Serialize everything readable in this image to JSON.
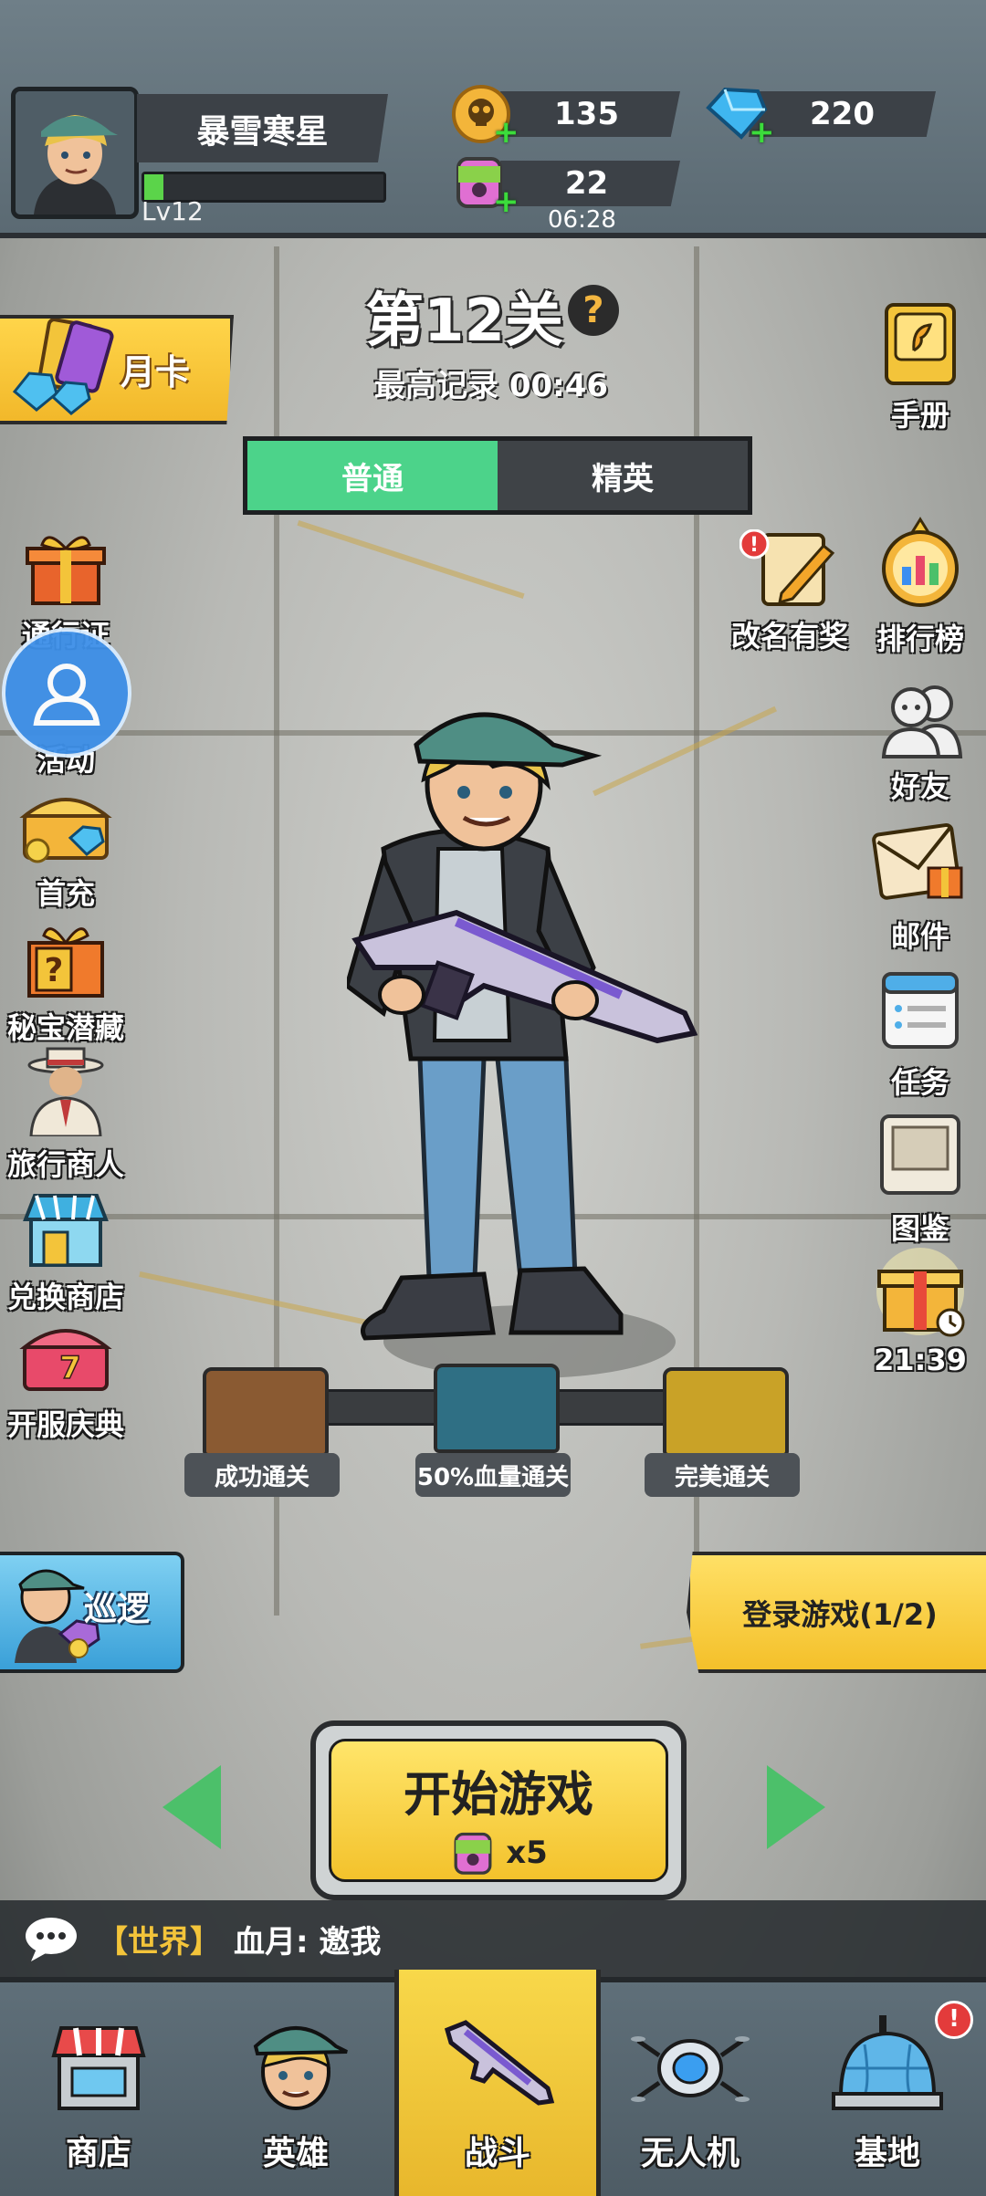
{
  "player": {
    "name": "暴雪寒星",
    "level": "Lv12",
    "xp_fraction": 0.08
  },
  "resources": {
    "skull_coins": "135",
    "gems": "220",
    "energy": "22",
    "energy_timer": "06:28"
  },
  "stage": {
    "title": "第12关",
    "help_icon": "?",
    "best_record": "最高记录 00:46",
    "tabs": [
      {
        "label": "普通",
        "active": true
      },
      {
        "label": "精英",
        "active": false
      }
    ]
  },
  "left_menu": {
    "month_card": "月卡",
    "items": [
      {
        "label": "通行证",
        "icon": "gift-icon"
      },
      {
        "label": "活动",
        "icon": "event-icon"
      },
      {
        "label": "首充",
        "icon": "treasure-chest-icon"
      },
      {
        "label": "秘宝潜藏",
        "icon": "mystery-box-icon"
      },
      {
        "label": "旅行商人",
        "icon": "merchant-icon"
      },
      {
        "label": "兑换商店",
        "icon": "shop-icon"
      },
      {
        "label": "开服庆典",
        "icon": "celebration-chest-icon"
      }
    ],
    "patrol": "巡逻"
  },
  "right_menu": {
    "items": [
      {
        "label": "手册",
        "icon": "handbook-icon"
      },
      {
        "label": "改名有奖",
        "icon": "rename-icon"
      },
      {
        "label": "排行榜",
        "icon": "trophy-icon"
      },
      {
        "label": "好友",
        "icon": "friends-icon"
      },
      {
        "label": "邮件",
        "icon": "mail-icon"
      },
      {
        "label": "任务",
        "icon": "tasks-icon"
      },
      {
        "label": "图鉴",
        "icon": "collection-icon"
      },
      {
        "label": "21:39",
        "icon": "timed-gift-icon"
      }
    ],
    "login_banner": "登录游戏(1/2)"
  },
  "rewards": [
    {
      "label": "成功通关",
      "color": "#8a5a32"
    },
    {
      "label": "50%血量通关",
      "color": "#2f6f84"
    },
    {
      "label": "完美通关",
      "color": "#c9a227"
    }
  ],
  "start": {
    "label": "开始游戏",
    "cost": "x5"
  },
  "chat": {
    "channel": "【世界】",
    "message": "血月: 邀我"
  },
  "nav": [
    {
      "label": "商店",
      "icon": "store-icon",
      "active": false
    },
    {
      "label": "英雄",
      "icon": "hero-icon",
      "active": false
    },
    {
      "label": "战斗",
      "icon": "rifle-icon",
      "active": true
    },
    {
      "label": "无人机",
      "icon": "drone-icon",
      "active": false
    },
    {
      "label": "基地",
      "icon": "base-dome-icon",
      "active": false
    }
  ],
  "colors": {
    "accent_green": "#4cd38a",
    "accent_yellow": "#f3c22c",
    "badge_red": "#e33b3b"
  }
}
